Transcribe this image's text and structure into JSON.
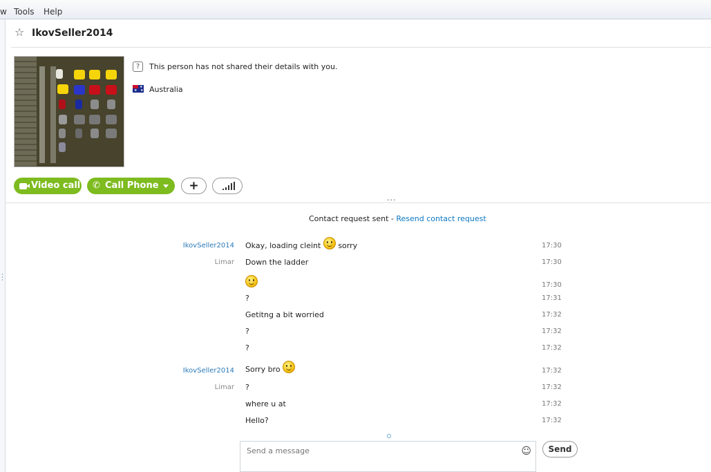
{
  "menu": {
    "partial": "w",
    "tools": "Tools",
    "help": "Help"
  },
  "contact": {
    "name": "IkovSeller2014",
    "details": "This person has not shared their details with you.",
    "country": "Australia"
  },
  "actions": {
    "video_call": "Video call",
    "call_phone": "Call Phone"
  },
  "status": {
    "request_sent": "Contact request sent - ",
    "resend_link": "Resend contact request"
  },
  "messages": [
    {
      "sender": "IkovSeller2014",
      "text": "Okay, loading cleint",
      "suffix": "sorry",
      "time": "17:30"
    },
    {
      "sender": "Limar",
      "text": "Down the ladder",
      "time": "17:30"
    },
    {
      "sender": "",
      "text": "",
      "time": "17:30"
    },
    {
      "sender": "",
      "text": "?",
      "time": "17:31"
    },
    {
      "sender": "",
      "text": "Getitng a bit worried",
      "time": "17:32"
    },
    {
      "sender": "",
      "text": "?",
      "time": "17:32"
    },
    {
      "sender": "",
      "text": "?",
      "time": "17:32"
    },
    {
      "sender": "IkovSeller2014",
      "text": "Sorry bro",
      "time": "17:32"
    },
    {
      "sender": "Limar",
      "text": "?",
      "time": "17:32"
    },
    {
      "sender": "",
      "text": "where u at",
      "time": "17:32"
    },
    {
      "sender": "",
      "text": "Hello?",
      "time": "17:32"
    }
  ],
  "compose": {
    "placeholder": "Send a message",
    "send": "Send"
  },
  "colors": {
    "accent_green": "#7dbb1f",
    "link_blue": "#0a78c2",
    "sender_blue": "#2a7ab8",
    "sender_gray": "#888888"
  },
  "icons": [
    "star-icon",
    "info-icon",
    "australia-flag-icon",
    "video-camera-icon",
    "phone-icon",
    "dropdown-arrow-icon",
    "plus-icon",
    "signal-bars-icon",
    "smiley-icon"
  ]
}
